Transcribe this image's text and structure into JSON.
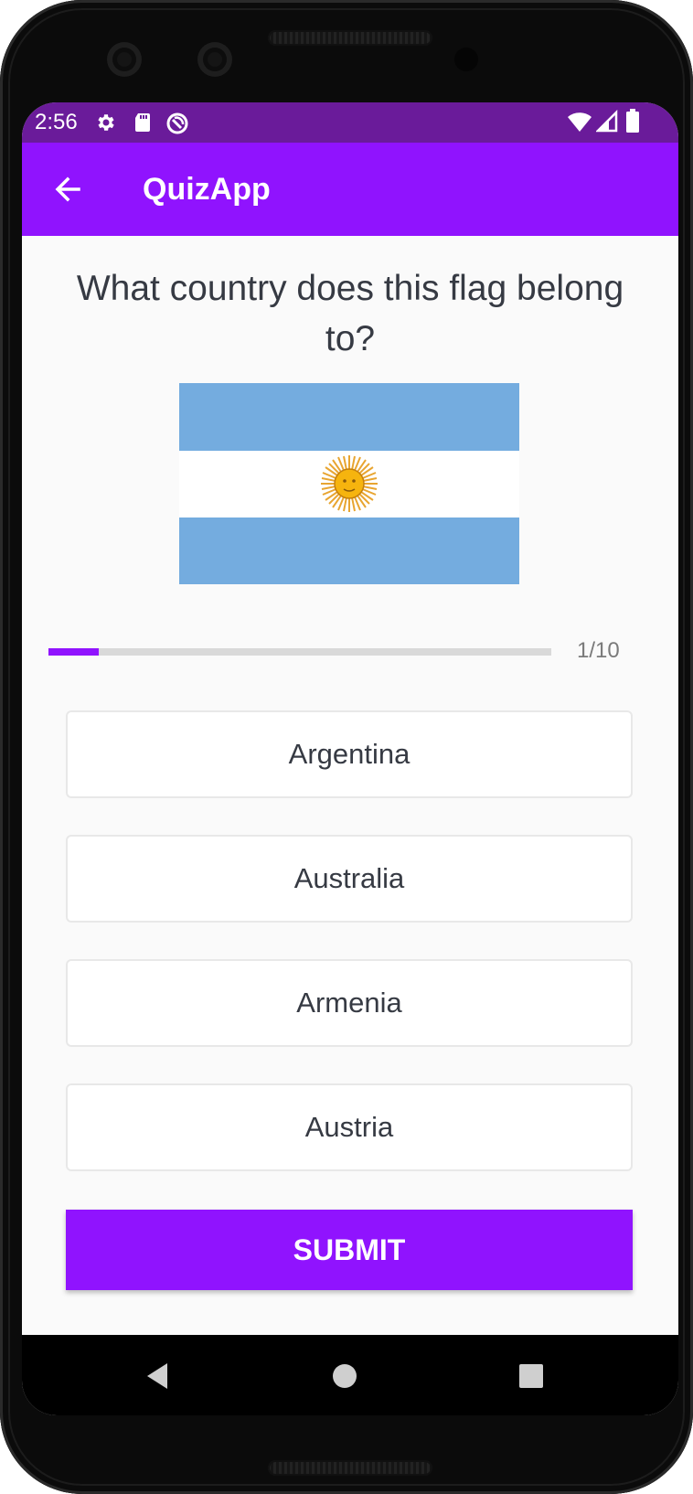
{
  "status_bar": {
    "time": "2:56",
    "left_icons": [
      "gear-icon",
      "sd-card-icon",
      "sync-icon"
    ],
    "right_icons": [
      "wifi-icon",
      "signal-icon",
      "battery-icon"
    ]
  },
  "app_bar": {
    "title": "QuizApp",
    "back_icon": "arrow-left-icon",
    "color": "#9013fe"
  },
  "question": {
    "text": "What country does this flag belong to?",
    "image": "argentina-flag"
  },
  "progress": {
    "current": 1,
    "total": 10,
    "text": "1/10",
    "fraction": 0.1
  },
  "options": [
    {
      "label": "Argentina"
    },
    {
      "label": "Australia"
    },
    {
      "label": "Armenia"
    },
    {
      "label": "Austria"
    }
  ],
  "submit": {
    "label": "SUBMIT"
  },
  "nav_bar": {
    "buttons": [
      "back-triangle-icon",
      "home-circle-icon",
      "recents-square-icon"
    ]
  },
  "colors": {
    "accent": "#9013fe",
    "status_bar": "#6a1b9a",
    "text": "#363a43",
    "flag_blue": "#74acdf"
  }
}
